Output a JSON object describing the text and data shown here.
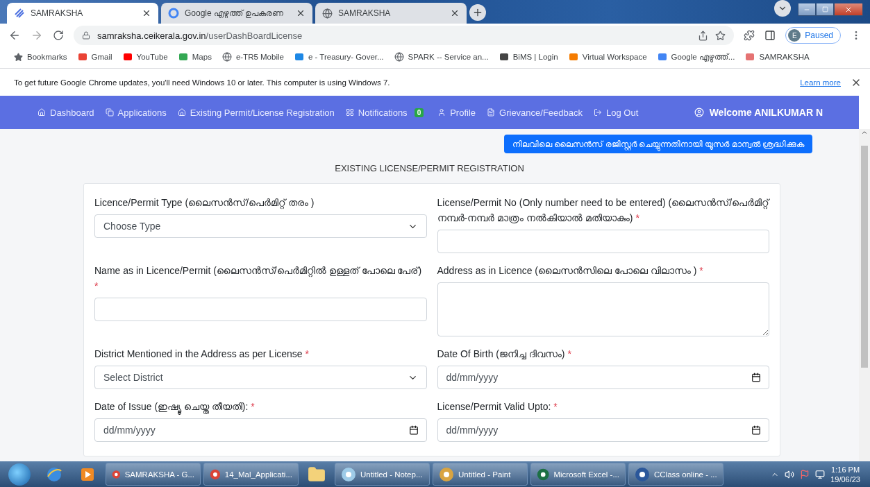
{
  "browser": {
    "tabs": [
      {
        "title": "SAMRAKSHA",
        "selected": true
      },
      {
        "title": "Google എഴുത്ത് ഉപകരണ",
        "selected": false
      },
      {
        "title": "SAMRAKSHA",
        "selected": false
      }
    ],
    "address": {
      "domain": "samraksha.ceikerala.gov.in",
      "path": "/userDashBoardLicense"
    },
    "profile": {
      "initial": "E",
      "status": "Paused"
    },
    "bookmarks": [
      {
        "label": "Bookmarks"
      },
      {
        "label": "Gmail"
      },
      {
        "label": "YouTube"
      },
      {
        "label": "Maps"
      },
      {
        "label": "e-TR5 Mobile"
      },
      {
        "label": "e - Treasury- Gover..."
      },
      {
        "label": "SPARK -- Service an..."
      },
      {
        "label": "BiMS | Login"
      },
      {
        "label": "Virtual Workspace"
      },
      {
        "label": "Google എഴുത്ത്..."
      },
      {
        "label": "SAMRAKSHA"
      }
    ]
  },
  "info_bar": {
    "message": "To get future Google Chrome updates, you'll need Windows 10 or later. This computer is using Windows 7.",
    "link": "Learn more"
  },
  "nav": {
    "items": [
      {
        "label": "Dashboard"
      },
      {
        "label": "Applications"
      },
      {
        "label": "Existing Permit/License Registration"
      },
      {
        "label": "Notifications",
        "badge": "0"
      },
      {
        "label": "Profile"
      },
      {
        "label": "Grievance/Feedback"
      },
      {
        "label": "Log Out"
      }
    ],
    "welcome": "Welcome ANILKUMAR N"
  },
  "help_button": "നിലവിലെ ലൈസൻസ് രജിസ്റ്റർ ചെയ്യുന്നതിനായി യൂസർ മാന്വൽ ശ്രദ്ധിക്കുക",
  "page_title": "EXISTING LICENSE/PERMIT REGISTRATION",
  "form": {
    "fields": [
      {
        "kind": "select",
        "label": "Licence/Permit Type (ലൈസൻസ്/പെർമിറ്റ് തരം )",
        "placeholder": "Choose Type"
      },
      {
        "kind": "text",
        "label": "License/Permit No (Only number need to be entered) (ലൈസൻസ്/പെർമിറ്റ് നമ്പർ-നമ്പർ മാത്രം നൽകിയാൽ മതിയാകും)",
        "required_mark": "*"
      },
      {
        "kind": "text",
        "label": "Name as in Licence/Permit (ലൈസൻസ്/പെർമിറ്റിൽ ഉള്ളത് പോലെ പേര്)",
        "required_mark": "*"
      },
      {
        "kind": "textarea",
        "label": "Address as in Licence (ലൈസൻസിലെ പോലെ വിലാസം )",
        "required_mark": "*"
      },
      {
        "kind": "select",
        "label": "District Mentioned in the Address as per License",
        "required_mark": "*",
        "placeholder": "Select District"
      },
      {
        "kind": "date",
        "label": "Date Of Birth (ജനിച്ച ദിവസം)",
        "required_mark": "*",
        "placeholder": "dd/mm/yyyy"
      },
      {
        "kind": "date",
        "label": "Date of Issue (ഇഷ്യൂ ചെയ്ത തീയതി):",
        "required_mark": "*",
        "placeholder": "dd/mm/yyyy"
      },
      {
        "kind": "date",
        "label": "License/Permit Valid Upto:",
        "required_mark": "*",
        "placeholder": "dd/mm/yyyy"
      }
    ]
  },
  "taskbar": {
    "apps": [
      {
        "label": "SAMRAKSHA - G..."
      },
      {
        "label": "14_Mal_Applicati..."
      },
      {
        "label": "Untitled - Notep..."
      },
      {
        "label": "Untitled - Paint"
      },
      {
        "label": "Microsoft Excel -..."
      },
      {
        "label": "CClass online - ..."
      }
    ],
    "time": "1:16 PM",
    "date": "19/06/23"
  }
}
